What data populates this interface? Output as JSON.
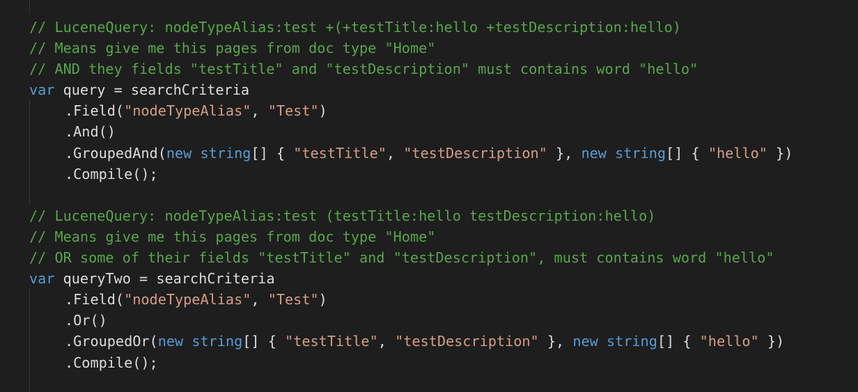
{
  "editor": {
    "theme": {
      "background": "#1e1e1e",
      "comment": "#57a64a",
      "keyword": "#569cd6",
      "string": "#d69d85",
      "text": "#dcdcdc"
    },
    "lines": [
      {
        "indent": false,
        "tokens": [
          {
            "t": "comment",
            "v": "// LuceneQuery: nodeTypeAlias:test +(+testTitle:hello +testDescription:hello)"
          }
        ]
      },
      {
        "indent": false,
        "tokens": [
          {
            "t": "comment",
            "v": "// Means give me this pages from doc type \"Home\""
          }
        ]
      },
      {
        "indent": false,
        "tokens": [
          {
            "t": "comment",
            "v": "// AND they fields \"testTitle\" and \"testDescription\" must contains word \"hello\""
          }
        ]
      },
      {
        "indent": false,
        "tokens": [
          {
            "t": "keyword",
            "v": "var"
          },
          {
            "t": "plain",
            "v": " query = searchCriteria"
          }
        ]
      },
      {
        "indent": true,
        "tokens": [
          {
            "t": "plain",
            "v": ".Field("
          },
          {
            "t": "string",
            "v": "\"nodeTypeAlias\""
          },
          {
            "t": "plain",
            "v": ", "
          },
          {
            "t": "string",
            "v": "\"Test\""
          },
          {
            "t": "plain",
            "v": ")"
          }
        ]
      },
      {
        "indent": true,
        "tokens": [
          {
            "t": "plain",
            "v": ".And()"
          }
        ]
      },
      {
        "indent": true,
        "tokens": [
          {
            "t": "plain",
            "v": ".GroupedAnd("
          },
          {
            "t": "keyword",
            "v": "new"
          },
          {
            "t": "plain",
            "v": " "
          },
          {
            "t": "keyword",
            "v": "string"
          },
          {
            "t": "plain",
            "v": "[] { "
          },
          {
            "t": "string",
            "v": "\"testTitle\""
          },
          {
            "t": "plain",
            "v": ", "
          },
          {
            "t": "string",
            "v": "\"testDescription\""
          },
          {
            "t": "plain",
            "v": " }, "
          },
          {
            "t": "keyword",
            "v": "new"
          },
          {
            "t": "plain",
            "v": " "
          },
          {
            "t": "keyword",
            "v": "string"
          },
          {
            "t": "plain",
            "v": "[] { "
          },
          {
            "t": "string",
            "v": "\"hello\""
          },
          {
            "t": "plain",
            "v": " })"
          }
        ]
      },
      {
        "indent": true,
        "tokens": [
          {
            "t": "plain",
            "v": ".Compile();"
          }
        ]
      },
      {
        "indent": false,
        "tokens": []
      },
      {
        "indent": false,
        "tokens": [
          {
            "t": "comment",
            "v": "// LuceneQuery: nodeTypeAlias:test (testTitle:hello testDescription:hello)"
          }
        ]
      },
      {
        "indent": false,
        "tokens": [
          {
            "t": "comment",
            "v": "// Means give me this pages from doc type \"Home\""
          }
        ]
      },
      {
        "indent": false,
        "tokens": [
          {
            "t": "comment",
            "v": "// OR some of their fields \"testTitle\" and \"testDescription\", must contains word \"hello\""
          }
        ]
      },
      {
        "indent": false,
        "tokens": [
          {
            "t": "keyword",
            "v": "var"
          },
          {
            "t": "plain",
            "v": " queryTwo = searchCriteria"
          }
        ]
      },
      {
        "indent": true,
        "tokens": [
          {
            "t": "plain",
            "v": ".Field("
          },
          {
            "t": "string",
            "v": "\"nodeTypeAlias\""
          },
          {
            "t": "plain",
            "v": ", "
          },
          {
            "t": "string",
            "v": "\"Test\""
          },
          {
            "t": "plain",
            "v": ")"
          }
        ]
      },
      {
        "indent": true,
        "tokens": [
          {
            "t": "plain",
            "v": ".Or()"
          }
        ]
      },
      {
        "indent": true,
        "tokens": [
          {
            "t": "plain",
            "v": ".GroupedOr("
          },
          {
            "t": "keyword",
            "v": "new"
          },
          {
            "t": "plain",
            "v": " "
          },
          {
            "t": "keyword",
            "v": "string"
          },
          {
            "t": "plain",
            "v": "[] { "
          },
          {
            "t": "string",
            "v": "\"testTitle\""
          },
          {
            "t": "plain",
            "v": ", "
          },
          {
            "t": "string",
            "v": "\"testDescription\""
          },
          {
            "t": "plain",
            "v": " }, "
          },
          {
            "t": "keyword",
            "v": "new"
          },
          {
            "t": "plain",
            "v": " "
          },
          {
            "t": "keyword",
            "v": "string"
          },
          {
            "t": "plain",
            "v": "[] { "
          },
          {
            "t": "string",
            "v": "\"hello\""
          },
          {
            "t": "plain",
            "v": " })"
          }
        ]
      },
      {
        "indent": true,
        "tokens": [
          {
            "t": "plain",
            "v": ".Compile();"
          }
        ]
      }
    ]
  }
}
